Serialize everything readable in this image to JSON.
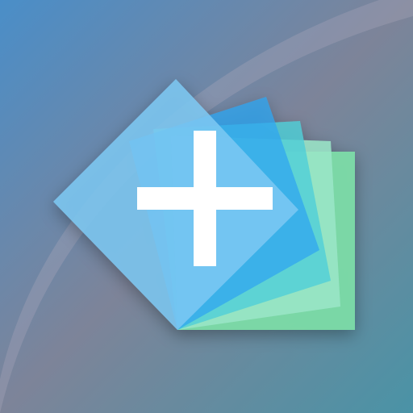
{
  "icon": {
    "glyph": "plus-icon",
    "description_name": "stacked-cards-add-app-icon",
    "colors": {
      "background_top_left": "#4a8ec8",
      "background_mid": "#7d8499",
      "background_bottom_right": "#4a93a6",
      "arc_light": "#a9a7bb",
      "card_front": "#7ec9f3",
      "card_blue": "#2fa6f0",
      "card_cyan": "#4fcfd8",
      "card_green": "#7ee0a8",
      "card_mint": "#9be6c8",
      "plus": "#ffffff"
    }
  }
}
